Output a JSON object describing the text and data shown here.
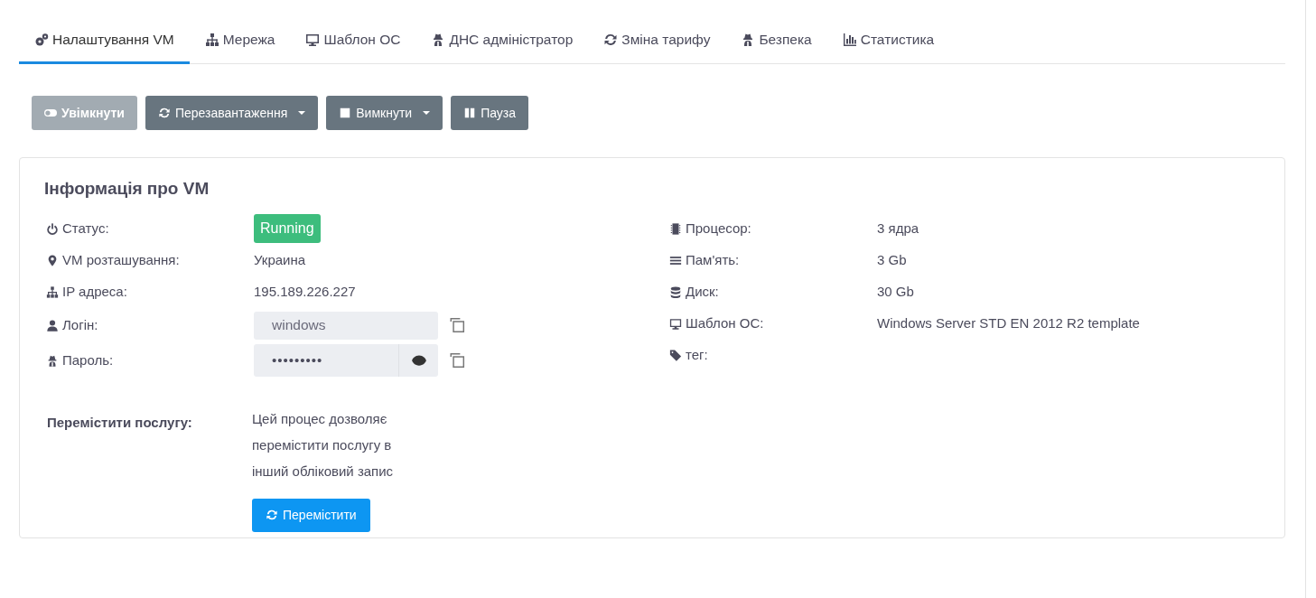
{
  "tabs": [
    {
      "label": "Налаштування VM",
      "selected": true
    },
    {
      "label": "Мережа",
      "selected": false
    },
    {
      "label": "Шаблон ОС",
      "selected": false
    },
    {
      "label": "ДНС адміністратор",
      "selected": false
    },
    {
      "label": "Зміна тарифу",
      "selected": false
    },
    {
      "label": "Безпека",
      "selected": false
    },
    {
      "label": "Статистика",
      "selected": false
    }
  ],
  "actions": [
    {
      "label": "Увімкнути",
      "disabled": true,
      "dropdown": false
    },
    {
      "label": "Перезавантаження",
      "disabled": false,
      "dropdown": true
    },
    {
      "label": "Вимкнути",
      "disabled": false,
      "dropdown": true
    },
    {
      "label": "Пауза",
      "disabled": false,
      "dropdown": false
    }
  ],
  "card": {
    "title": "Інформація про VM",
    "left": [
      {
        "kind": "badge",
        "label": "Статус:",
        "value": "Running"
      },
      {
        "kind": "text",
        "label": "VM розташування:",
        "value": "Украина"
      },
      {
        "kind": "text",
        "label": "IP адреса:",
        "value": "195.189.226.227"
      },
      {
        "kind": "field",
        "label": "Логін:",
        "value": "windows"
      },
      {
        "kind": "secret",
        "label": "Пароль:",
        "value": "•••••••••"
      }
    ],
    "right": [
      {
        "label": "Процесор:",
        "value": "3 ядра"
      },
      {
        "label": "Пам'ять:",
        "value": "3 Gb"
      },
      {
        "label": "Диск:",
        "value": "30 Gb"
      },
      {
        "label": "Шаблон ОС:",
        "value": "Windows Server STD EN 2012 R2 template"
      },
      {
        "label": "тег:"
      }
    ],
    "move": {
      "label": "Перемістити послугу:",
      "text": "Цей процес дозволяє перемістити послугу в інший обліковий запис",
      "button": "Перемістити"
    }
  }
}
